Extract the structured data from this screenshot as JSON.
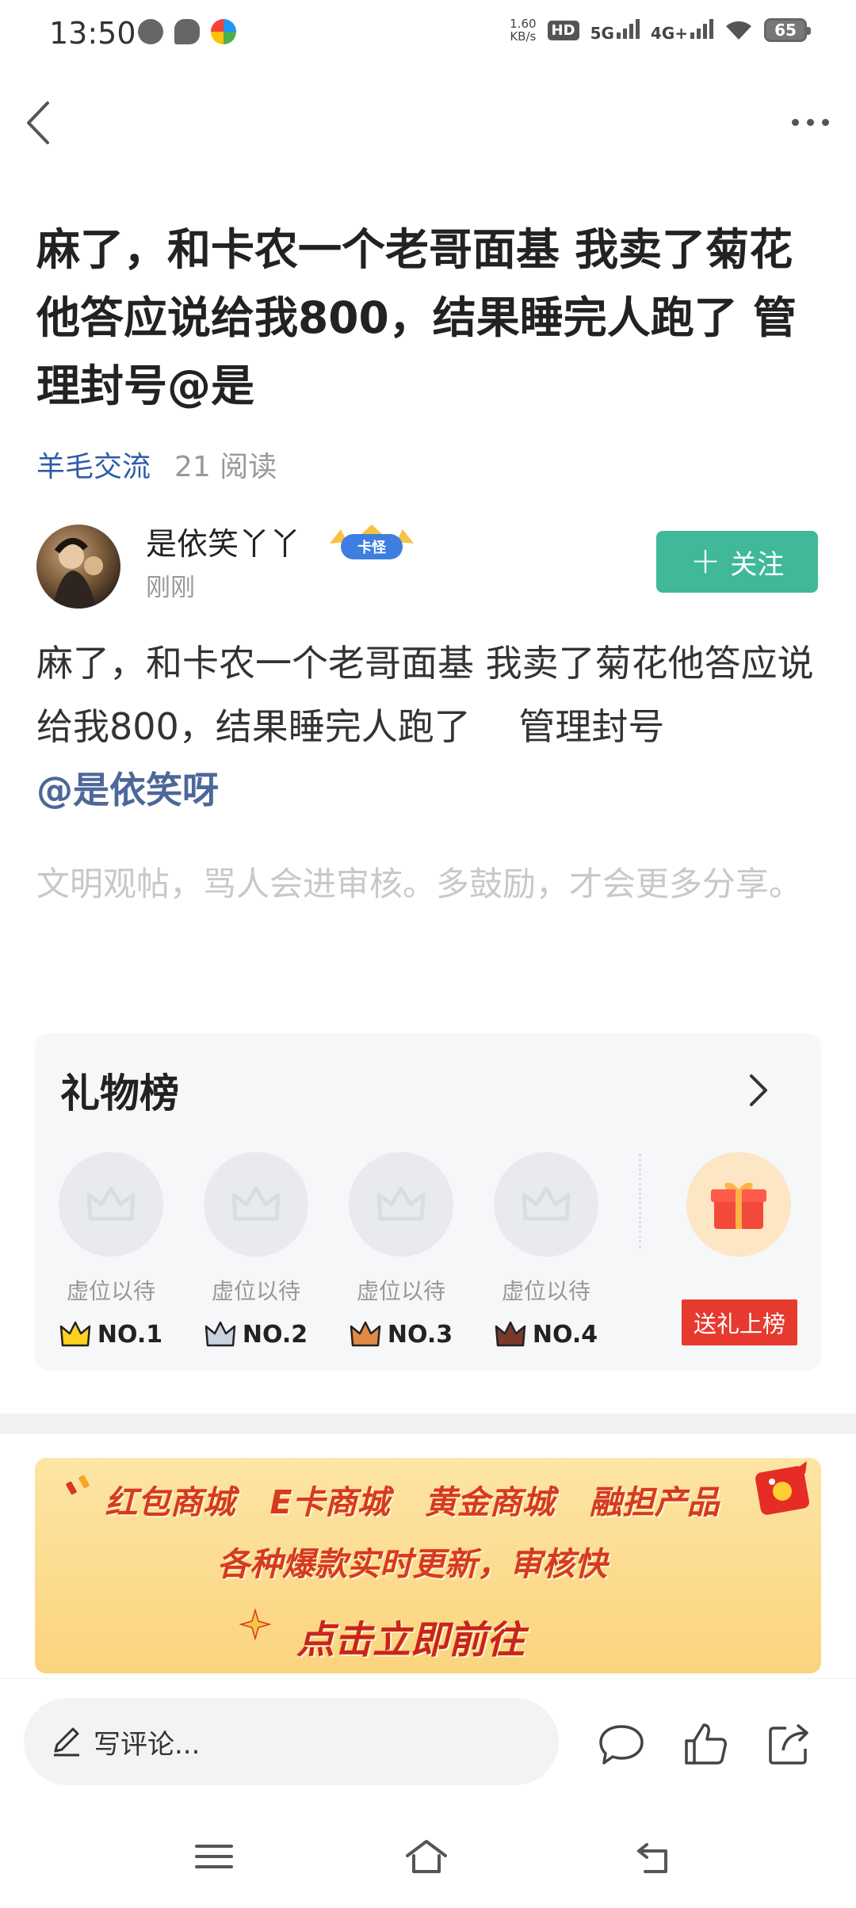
{
  "status_bar": {
    "time": "13:50",
    "network_speed": "1.60",
    "network_speed_unit": "KB/s",
    "hd_label": "HD",
    "signal1": "5G",
    "signal2": "4G+",
    "battery": "65"
  },
  "post": {
    "title": "麻了，和卡农一个老哥面基 我卖了菊花他答应说给我800，结果睡完人跑了 管理封号@是",
    "category": "羊毛交流",
    "read_count": "21 阅读",
    "author": {
      "name": "是依笑丫丫",
      "badge": "卡怪",
      "time": "刚刚"
    },
    "follow_label": "关注",
    "body": "麻了，和卡农一个老哥面基 我卖了菊花他答应说给我800，结果睡完人跑了 　管理封号",
    "mention": "@是依笑呀",
    "civil_notice": "文明观帖，骂人会进审核。多鼓励，才会更多分享。"
  },
  "gift_board": {
    "title": "礼物榜",
    "slots": [
      {
        "label": "虚位以待",
        "rank": "NO.1"
      },
      {
        "label": "虚位以待",
        "rank": "NO.2"
      },
      {
        "label": "虚位以待",
        "rank": "NO.3"
      },
      {
        "label": "虚位以待",
        "rank": "NO.4"
      }
    ],
    "send_gift_label": "送礼上榜"
  },
  "banner": {
    "items": [
      "红包商城",
      "E卡商城",
      "黄金商城",
      "融担产品"
    ],
    "subtitle": "各种爆款实时更新，审核快",
    "cta": "点击立即前往"
  },
  "bottom_bar": {
    "comment_placeholder": "写评论..."
  },
  "colors": {
    "accent_green": "#3fb99a",
    "category_blue": "#2f5ca8",
    "mention_blue": "#4d6799",
    "gift_red": "#e73a2f"
  }
}
